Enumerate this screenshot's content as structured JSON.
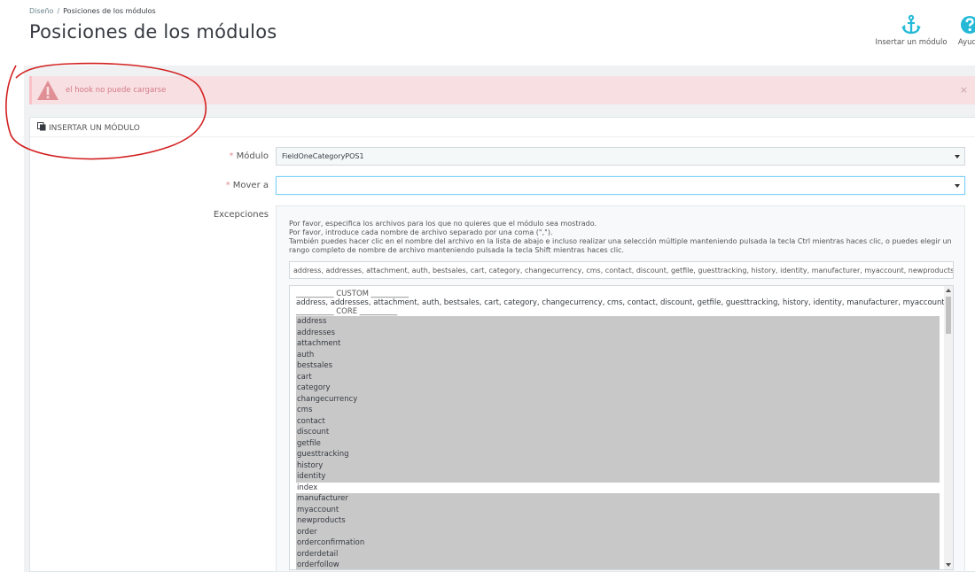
{
  "breadcrumb": {
    "parent": "Diseño",
    "separator": "/",
    "current": "Posiciones de los módulos"
  },
  "page_title": "Posiciones de los módulos",
  "toolbar": {
    "insert_label": "Insertar un módulo",
    "help_label": "Ayuda"
  },
  "alert": {
    "message": "el hook no puede cargarse",
    "close": "×"
  },
  "panel": {
    "heading": "INSERTAR UN MÓDULO"
  },
  "form": {
    "module_label": "Módulo",
    "module_value": "FieldOneCategoryPOS1",
    "move_label": "Mover a",
    "move_value": "",
    "required_mark": "*",
    "exceptions_label": "Excepciones"
  },
  "exceptions": {
    "help_lines": [
      "Por favor, especifica los archivos para los que no quieres que el módulo sea mostrado.",
      "Por favor, introduce cada nombre de archivo separado por una coma (\",\").",
      "También puedes hacer clic en el nombre del archivo en la lista de abajo e incluso realizar una selección múltiple manteniendo pulsada la tecla Ctrl mientras haces clic, o puedes elegir un rango completo de nombre de archivo manteniendo pulsada la tecla Shift mientras haces clic."
    ],
    "files_value": "address, addresses, attachment, auth, bestsales, cart, category, changecurrency, cms, contact, discount, getfile, guesttracking, history, identity, manufacturer, myaccount, newproducts, c",
    "custom_header": "__________ CUSTOM __________",
    "custom_line": "address, addresses, attachment, auth, bestsales, cart, category, changecurrency, cms, contact, discount, getfile, guesttracking, history, identity, manufacturer, myaccount, newproducts",
    "core_header": "__________ CORE __________",
    "options": [
      {
        "label": "address",
        "selected": true
      },
      {
        "label": "addresses",
        "selected": true
      },
      {
        "label": "attachment",
        "selected": true
      },
      {
        "label": "auth",
        "selected": true
      },
      {
        "label": "bestsales",
        "selected": true
      },
      {
        "label": "cart",
        "selected": true
      },
      {
        "label": "category",
        "selected": true
      },
      {
        "label": "changecurrency",
        "selected": true
      },
      {
        "label": "cms",
        "selected": true
      },
      {
        "label": "contact",
        "selected": true
      },
      {
        "label": "discount",
        "selected": true
      },
      {
        "label": "getfile",
        "selected": true
      },
      {
        "label": "guesttracking",
        "selected": true
      },
      {
        "label": "history",
        "selected": true
      },
      {
        "label": "identity",
        "selected": true
      },
      {
        "label": "index",
        "selected": false
      },
      {
        "label": "manufacturer",
        "selected": true
      },
      {
        "label": "myaccount",
        "selected": true
      },
      {
        "label": "newproducts",
        "selected": true
      },
      {
        "label": "order",
        "selected": true
      },
      {
        "label": "orderconfirmation",
        "selected": true
      },
      {
        "label": "orderdetail",
        "selected": true
      },
      {
        "label": "orderfollow",
        "selected": true
      }
    ]
  },
  "colors": {
    "accent": "#25b9d7",
    "alert_bg": "#f8dfe2",
    "alert_text": "#d37b87",
    "annotation": "#d32020"
  },
  "icons": {
    "insert": "anchor-icon",
    "help": "question-circle-icon",
    "alert": "warning-triangle-icon",
    "panel": "clone-icon"
  }
}
